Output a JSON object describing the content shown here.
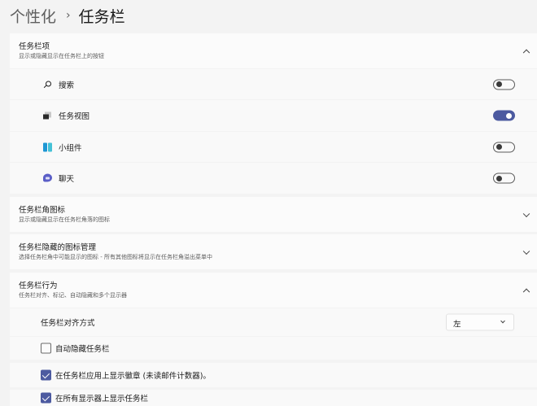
{
  "breadcrumb": {
    "parent": "个性化",
    "separator": "›",
    "current": "任务栏"
  },
  "taskbar_items": {
    "title": "任务栏项",
    "subtitle": "显示或隐藏显示在任务栏上的按钮",
    "expanded": true,
    "items": [
      {
        "label": "搜索",
        "state": "关",
        "on": false,
        "icon": "search-icon"
      },
      {
        "label": "任务视图",
        "state": "开",
        "on": true,
        "icon": "task-view-icon"
      },
      {
        "label": "小组件",
        "state": "关",
        "on": false,
        "icon": "widgets-icon"
      },
      {
        "label": "聊天",
        "state": "关",
        "on": false,
        "icon": "chat-icon"
      }
    ]
  },
  "corner_icons": {
    "title": "任务栏角图标",
    "subtitle": "显示或隐藏显示在任务栏角落的图标",
    "expanded": false
  },
  "overflow": {
    "title": "任务栏隐藏的图标管理",
    "subtitle": "选择任务栏角中可能显示的图标 - 所有其他图标将显示在任务栏角溢出菜单中",
    "expanded": false
  },
  "behaviors": {
    "title": "任务栏行为",
    "subtitle": "任务栏对齐、标记、自动隐藏和多个显示器",
    "expanded": true,
    "alignment": {
      "label": "任务栏对齐方式",
      "value": "左"
    },
    "auto_hide": {
      "label": "自动隐藏任务栏",
      "checked": false
    },
    "badges": {
      "label": "在任务栏应用上显示徽章 (未读邮件计数器)。",
      "checked": true
    },
    "all_displays": {
      "label": "在所有显示器上显示任务栏",
      "checked": true
    }
  },
  "colors": {
    "accent": "#4c5aa0",
    "background": "#f3f3f3",
    "card": "#fbfbfb"
  }
}
